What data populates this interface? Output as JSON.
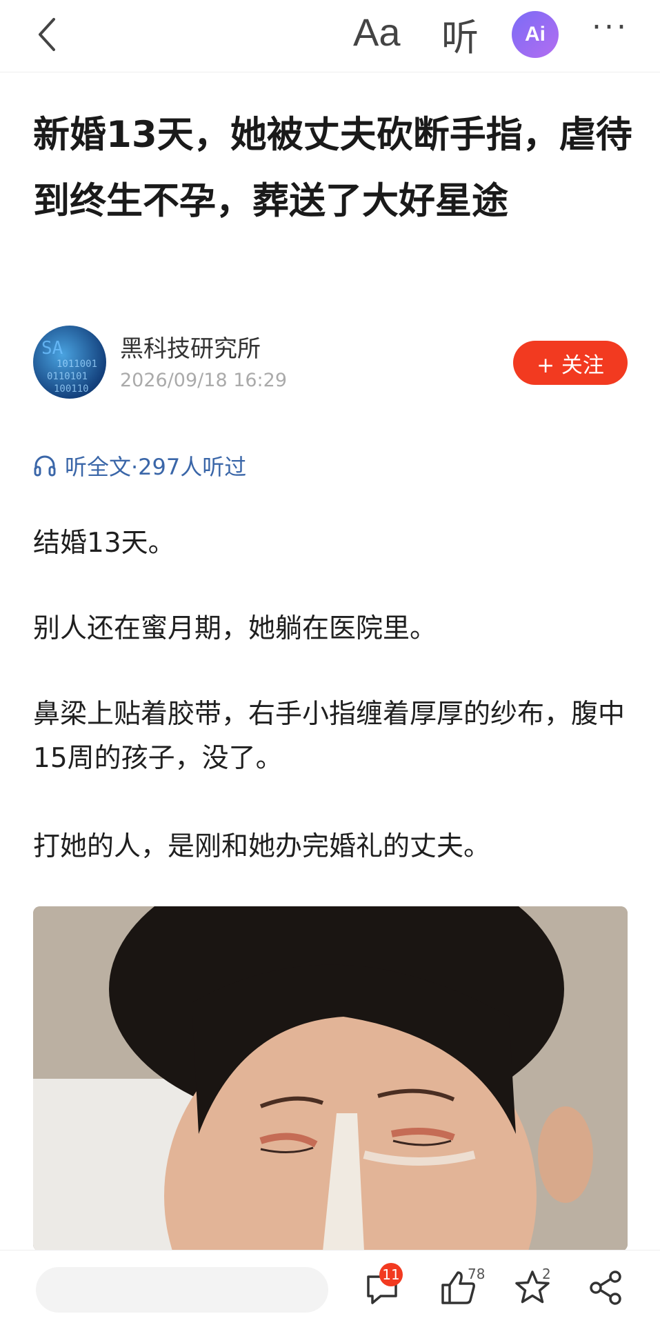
{
  "header": {
    "font_label": "Aa",
    "listen_label": "听",
    "ai_label": "Ai",
    "more_label": "···"
  },
  "article": {
    "title": "新婚13天，她被丈夫砍断手指，虐待到终生不孕，葬送了大好星途",
    "author": "黑科技研究所",
    "datetime": "2026/09/18 16:29",
    "follow_label": "+ 关注",
    "listen_all": "听全文·297人听过",
    "paragraphs": [
      "结婚13天。",
      "别人还在蜜月期，她躺在医院里。",
      "鼻梁上贴着胶带，右手小指缠着厚厚的纱布，腹中15周的孩子，没了。",
      "打她的人，是刚和她办完婚礼的丈夫。"
    ]
  },
  "bottom_bar": {
    "comment_count": "11",
    "like_count": "78",
    "favorite_count": "2"
  },
  "colors": {
    "accent": "#f23a20",
    "link": "#3a66a8"
  }
}
